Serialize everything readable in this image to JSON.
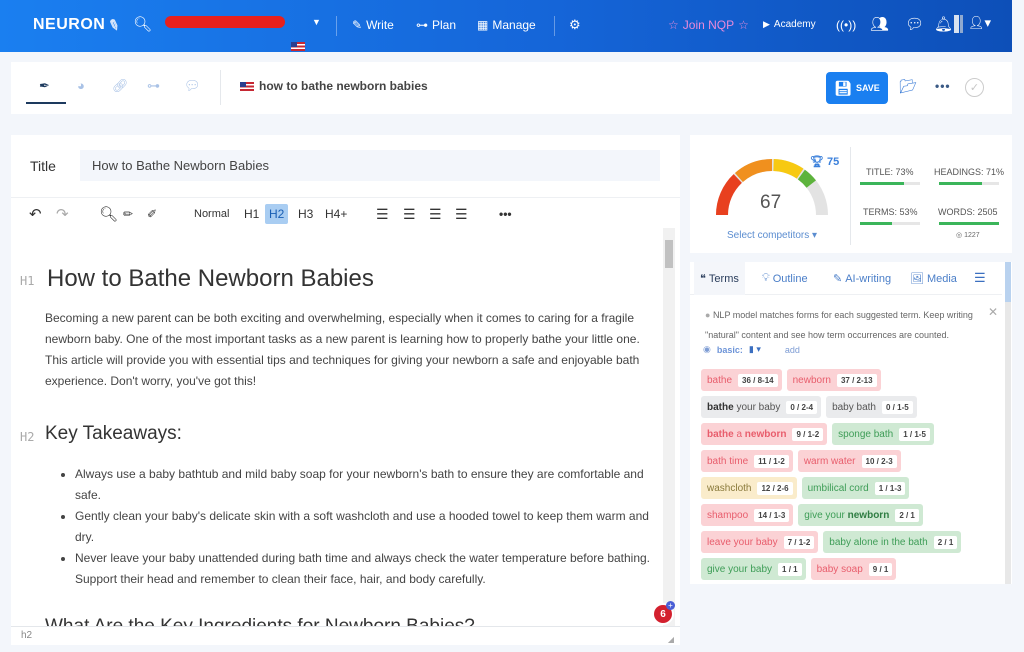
{
  "nav": {
    "logo": "NEURON",
    "project_name_redacted": true,
    "items": [
      {
        "label": "Write",
        "icon": "feather-icon"
      },
      {
        "label": "Plan",
        "icon": "sitemap-icon"
      },
      {
        "label": "Manage",
        "icon": "calendar-icon"
      }
    ],
    "join": "Join NQP",
    "academy": "Academy"
  },
  "toolbar": {
    "tabs": [
      "editor",
      "analysis",
      "links",
      "structure",
      "chat"
    ],
    "keyword": "how to bathe newborn babies",
    "save_label": "SAVE",
    "more": "•••"
  },
  "editor": {
    "title_label": "Title",
    "title_value": "How to Bathe Newborn Babies",
    "format": {
      "normal": "Normal",
      "h1": "H1",
      "h2": "H2",
      "h3": "H3",
      "h4": "H4+",
      "active": "H2",
      "more": "•••"
    },
    "h1_tag": "H1",
    "h1": "How to Bathe Newborn Babies",
    "intro": "Becoming a new parent can be both exciting and overwhelming, especially when it comes to caring for a fragile newborn baby. One of the most important tasks as a new parent is learning how to properly bathe your little one. This article will provide you with essential tips and techniques for giving your newborn a safe and enjoyable bath experience. Don't worry, you've got this!",
    "h2_tag": "H2",
    "h2": "Key Takeaways:",
    "bullets": [
      "Always use a baby bathtub and mild baby soap for your newborn's bath to ensure they are comfortable and safe.",
      "Gently clean your baby's delicate skin with a soft washcloth and use a hooded towel to keep them warm and dry.",
      "Never leave your baby unattended during bath time and always check the water temperature before bathing. Support their head and remember to clean their face, hair, and body carefully."
    ],
    "next_heading_partial": "What Are the Key Ingredients for Newborn Babies?",
    "badge_count": "6",
    "status_path": "h2"
  },
  "score": {
    "value": "67",
    "target": "75",
    "select_competitors": "Select competitors ▾",
    "metrics": [
      {
        "label": "TITLE: 73%",
        "progress": 0.73
      },
      {
        "label": "HEADINGS: 71%",
        "progress": 0.71
      },
      {
        "label": "TERMS: 53%",
        "progress": 0.53
      },
      {
        "label": "WORDS: 2505",
        "progress": 1.0
      }
    ],
    "words_target": "1227",
    "colors": {
      "red": "#e8401f",
      "orange": "#f0901e",
      "yellow": "#f7c912",
      "green": "#5db33c",
      "gray": "#e3e3e3"
    }
  },
  "terms": {
    "tabs": [
      "Terms",
      "Outline",
      "AI-writing",
      "Media"
    ],
    "notice": "NLP model matches forms for each suggested term. Keep writing \"natural\" content and see how term occurrences are counted.",
    "filter_label": "basic:",
    "add_label": "add",
    "chips": [
      {
        "html": "bathe",
        "count": "36 / 8-14",
        "status": "red"
      },
      {
        "html": "newborn",
        "count": "37 / 2-13",
        "status": "red"
      },
      {
        "html": "<b>bathe</b> your baby",
        "count": "0 / 2-4",
        "status": "gray"
      },
      {
        "html": "baby bath",
        "count": "0 / 1-5",
        "status": "gray"
      },
      {
        "html": "<b>bathe</b> a <b>newborn</b>",
        "count": "9 / 1-2",
        "status": "red"
      },
      {
        "html": "sponge bath",
        "count": "1 / 1-5",
        "status": "green"
      },
      {
        "html": "bath time",
        "count": "11 / 1-2",
        "status": "red"
      },
      {
        "html": "warm water",
        "count": "10 / 2-3",
        "status": "red"
      },
      {
        "html": "washcloth",
        "count": "12 / 2-6",
        "status": "yellow"
      },
      {
        "html": "umbilical cord",
        "count": "1 / 1-3",
        "status": "green"
      },
      {
        "html": "shampoo",
        "count": "14 / 1-3",
        "status": "red"
      },
      {
        "html": "give your <b>newborn</b>",
        "count": "2 / 1",
        "status": "green"
      },
      {
        "html": "leave your baby",
        "count": "7 / 1-2",
        "status": "red"
      },
      {
        "html": "baby alone in the bath",
        "count": "2 / 1",
        "status": "green"
      },
      {
        "html": "give your baby",
        "count": "1 / 1",
        "status": "green"
      },
      {
        "html": "baby soap",
        "count": "9 / 1",
        "status": "red"
      }
    ]
  }
}
